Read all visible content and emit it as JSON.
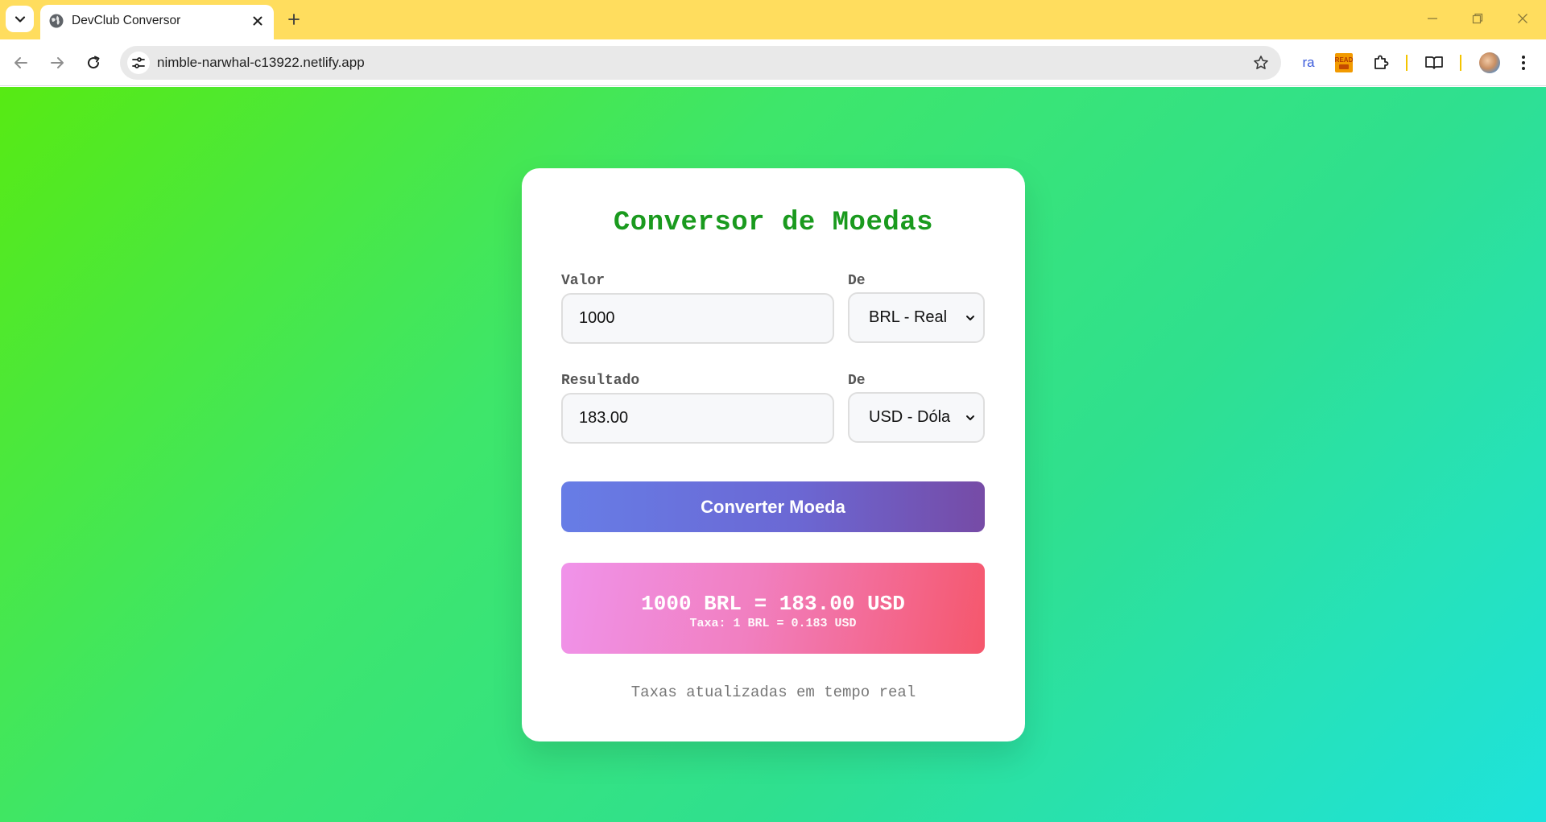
{
  "browser": {
    "tab_title": "DevClub Conversor",
    "url": "nimble-narwhal-c13922.netlify.app",
    "extensions": [
      "ra",
      "READ"
    ]
  },
  "app": {
    "title": "Conversor de Moedas",
    "amount_label": "Valor",
    "amount_value": "1000",
    "from_label": "De",
    "from_selected": "BRL - Real",
    "result_label": "Resultado",
    "result_value": "183.00",
    "to_label": "De",
    "to_selected": "USD - Dóla",
    "convert_button": "Converter Moeda",
    "result_main": "1000 BRL = 183.00 USD",
    "result_rate": "Taxa: 1 BRL = 0.183 USD",
    "footer_note": "Taxas atualizadas em tempo real"
  },
  "colors": {
    "tabstrip": "#ffdd5e",
    "title": "#1a9a1e",
    "button_start": "#677de6",
    "button_end": "#764ba6",
    "result_start": "#f093ea",
    "result_end": "#f5576c"
  }
}
